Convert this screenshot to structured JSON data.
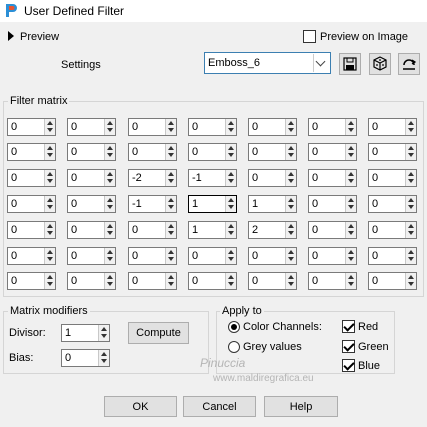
{
  "window": {
    "title": "User Defined Filter"
  },
  "preview": {
    "label": "Preview",
    "preview_on_image_label": "Preview on Image",
    "preview_on_image_checked": false
  },
  "settings": {
    "label": "Settings",
    "selected": "Emboss_6"
  },
  "filter_matrix": {
    "title": "Filter matrix",
    "rows": [
      [
        "0",
        "0",
        "0",
        "0",
        "0",
        "0",
        "0"
      ],
      [
        "0",
        "0",
        "0",
        "0",
        "0",
        "0",
        "0"
      ],
      [
        "0",
        "0",
        "-2",
        "-1",
        "0",
        "0",
        "0"
      ],
      [
        "0",
        "0",
        "-1",
        "1",
        "1",
        "0",
        "0"
      ],
      [
        "0",
        "0",
        "0",
        "1",
        "2",
        "0",
        "0"
      ],
      [
        "0",
        "0",
        "0",
        "0",
        "0",
        "0",
        "0"
      ],
      [
        "0",
        "0",
        "0",
        "0",
        "0",
        "0",
        "0"
      ]
    ]
  },
  "matrix_modifiers": {
    "title": "Matrix modifiers",
    "divisor_label": "Divisor:",
    "divisor_value": "1",
    "compute_label": "Compute",
    "bias_label": "Bias:",
    "bias_value": "0"
  },
  "apply_to": {
    "title": "Apply to",
    "color_channels_label": "Color Channels:",
    "grey_values_label": "Grey values",
    "red_label": "Red",
    "green_label": "Green",
    "blue_label": "Blue"
  },
  "buttons": {
    "ok": "OK",
    "cancel": "Cancel",
    "help": "Help"
  },
  "watermark": {
    "line1": "Pinuccia",
    "line2": "www.maldiregrafica.eu"
  }
}
